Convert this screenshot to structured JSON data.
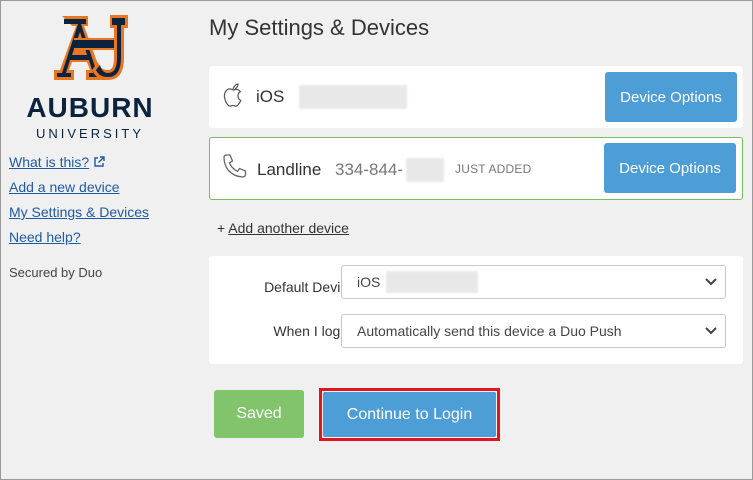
{
  "sidebar": {
    "logo_text": "AU",
    "wordmark_line1": "AUBURN",
    "wordmark_line2": "UNIVERSITY",
    "links": [
      {
        "label": "What is this?"
      },
      {
        "label": "Add a new device"
      },
      {
        "label": "My Settings & Devices"
      },
      {
        "label": "Need help?"
      }
    ],
    "secured_by": "Secured by Duo"
  },
  "main": {
    "title": "My Settings & Devices",
    "devices": [
      {
        "icon": "apple-icon",
        "name": "iOS",
        "number": "",
        "badge": "",
        "options_label": "Device Options"
      },
      {
        "icon": "phone-icon",
        "name": "Landline",
        "number": "334-844-",
        "badge": "JUST ADDED",
        "options_label": "Device Options"
      }
    ],
    "add_another_prefix": "+ ",
    "add_another_label": "Add another device",
    "settings": {
      "default_device_label": "Default Device:",
      "default_device_value": "iOS",
      "when_login_label": "When I log in:",
      "when_login_value": "Automatically send this device a Duo Push"
    },
    "saved_label": "Saved",
    "continue_label": "Continue to Login"
  },
  "colors": {
    "accent_blue": "#4d9dd6",
    "saved_green": "#82c46c",
    "highlight_red": "#e0161e",
    "auburn_navy": "#0c2340",
    "auburn_orange": "#e87722"
  }
}
